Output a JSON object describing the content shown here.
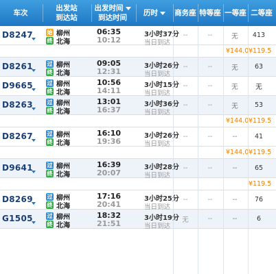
{
  "header": {
    "train_no": "车次",
    "station_from": "出发站",
    "station_to": "到达站",
    "time_dep": "出发时间",
    "time_arr": "到达时间",
    "duration": "历时",
    "business": "商务座",
    "special": "特等座",
    "first": "一等座",
    "second": "二等座"
  },
  "stations": {
    "from": "柳州",
    "to": "北海"
  },
  "tags": {
    "start": "始",
    "pass": "过",
    "end": "终"
  },
  "rows": [
    {
      "train": "D8247",
      "from_tag": "始",
      "dep": "06:35",
      "arr": "10:12",
      "duration": "3小时37分",
      "note": "当日到达",
      "business": "--",
      "special": "--",
      "first": "无",
      "second": "413",
      "price_first": "¥144.0",
      "price_second": "¥119.5"
    },
    {
      "train": "D8261",
      "from_tag": "过",
      "dep": "09:05",
      "arr": "12:31",
      "duration": "3小时26分",
      "note": "当日到达",
      "business": "--",
      "special": "--",
      "first": "无",
      "second": "63"
    },
    {
      "train": "D9665",
      "from_tag": "过",
      "dep": "10:56",
      "arr": "14:11",
      "duration": "3小时15分",
      "note": "当日到达",
      "business": "--",
      "special": "--",
      "first": "无",
      "second": "无"
    },
    {
      "train": "D8263",
      "from_tag": "过",
      "dep": "13:01",
      "arr": "16:37",
      "duration": "3小时36分",
      "note": "当日到达",
      "business": "--",
      "special": "--",
      "first": "无",
      "second": "53",
      "price_first": "¥144.0",
      "price_second": "¥119.5"
    },
    {
      "train": "D8267",
      "from_tag": "过",
      "dep": "16:10",
      "arr": "19:36",
      "duration": "3小时26分",
      "note": "当日到达",
      "business": "--",
      "special": "--",
      "first": "--",
      "second": "41",
      "price_first": "¥144.0",
      "price_second": "¥119.5"
    },
    {
      "train": "D9641",
      "from_tag": "过",
      "dep": "16:39",
      "arr": "20:07",
      "duration": "3小时28分",
      "note": "当日到达",
      "business": "--",
      "special": "--",
      "first": "--",
      "second": "65",
      "price_second": "¥119.5"
    },
    {
      "train": "D8269",
      "from_tag": "过",
      "dep": "17:16",
      "arr": "20:41",
      "duration": "3小时25分",
      "note": "当日到达",
      "business": "--",
      "special": "--",
      "first": "--",
      "second": "76"
    },
    {
      "train": "G1505",
      "from_tag": "过",
      "dep": "18:32",
      "arr": "21:51",
      "duration": "3小时19分",
      "note": "当日到达",
      "business": "无",
      "special": "--",
      "first": "--",
      "second": "6"
    }
  ]
}
